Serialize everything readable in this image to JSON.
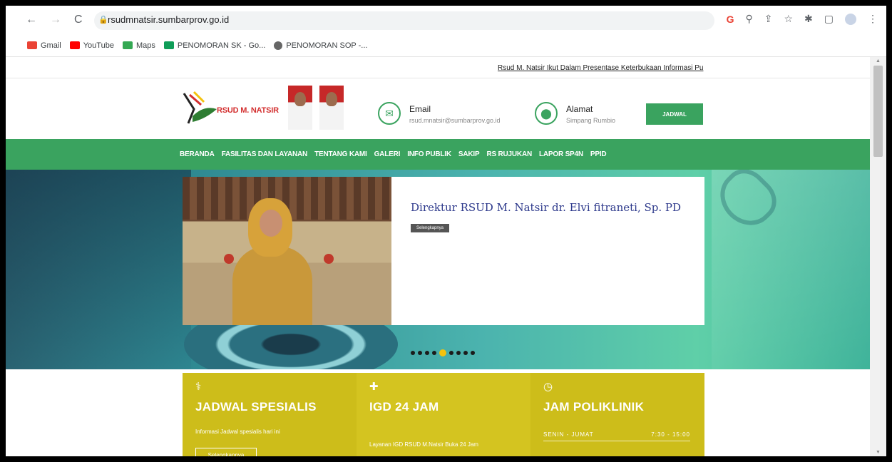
{
  "browser": {
    "nav": {
      "back": "←",
      "forward": "→",
      "reload": "C"
    },
    "url": "rsudmnatsir.sumbarprov.go.id",
    "icons": [
      "google-icon",
      "zoom-icon",
      "share-icon",
      "star-icon",
      "extensions-icon",
      "sidepanel-icon",
      "profile-icon",
      "menu-icon"
    ],
    "bookmarks": [
      {
        "label": "Gmail",
        "icon": "gmail-icon"
      },
      {
        "label": "YouTube",
        "icon": "youtube-icon"
      },
      {
        "label": "Maps",
        "icon": "maps-icon"
      },
      {
        "label": "PENOMORAN SK - Go...",
        "icon": "sheets-icon"
      },
      {
        "label": "PENOMORAN SOP -...",
        "icon": "globe-icon"
      }
    ]
  },
  "site": {
    "ticker": "Rsud M. Natsir Ikut Dalam Presentase Keterbukaan Informasi Pu",
    "logo_text": "RSUD M. NATSIR",
    "contacts": [
      {
        "title": "Email",
        "value": "rsud.mnatsir@sumbarprov.go.id",
        "icon": "mail-icon"
      },
      {
        "title": "Alamat",
        "value": "Simpang Rumbio",
        "icon": "location-pin-icon"
      }
    ],
    "jadwal_button": "JADWAL",
    "menu": [
      "BERANDA",
      "FASILITAS DAN LAYANAN",
      "TENTANG KAMI",
      "GALERI",
      "INFO PUBLIK",
      "SAKIP",
      "RS RUJUKAN",
      "LAPOR SP4N",
      "PPID"
    ],
    "slider": {
      "title": "Direktur RSUD M. Natsir dr. Elvi fitraneti, Sp. PD",
      "more": "Selengkapnya",
      "dot_count": 9,
      "active_index": 4
    },
    "cards": [
      {
        "title": "JADWAL SPESIALIS",
        "desc": "Informasi Jadwal spesialis hari ini",
        "button": "Selengkapnya",
        "icon": "stethoscope-icon"
      },
      {
        "title": "IGD 24 JAM",
        "desc": "Layanan IGD RSUD M.Natsir Buka 24 Jam",
        "icon": "ambulance-icon"
      },
      {
        "title": "JAM POLIKLINIK",
        "days": "SENIN - JUMAT",
        "hours": "7:30 - 15:00",
        "icon": "clock-icon"
      }
    ]
  },
  "colors": {
    "brand_green": "#3aa35f",
    "card_yellow": "#cdbd1a",
    "slider_dot_active": "#f4c20d"
  }
}
